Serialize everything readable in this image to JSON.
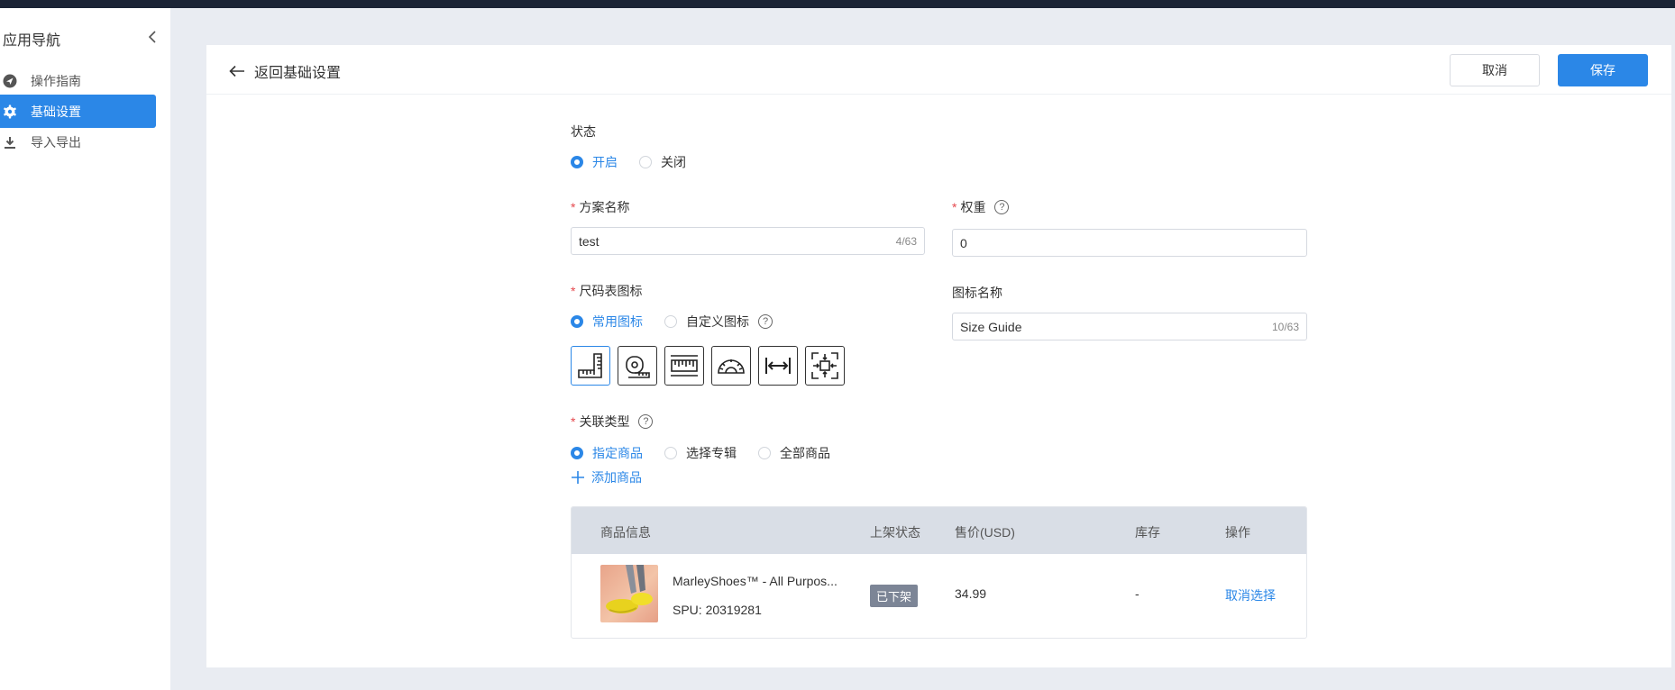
{
  "sidebar": {
    "title": "应用导航",
    "items": [
      {
        "label": "操作指南",
        "icon": "send-icon",
        "active": false
      },
      {
        "label": "基础设置",
        "icon": "gear-icon",
        "active": true
      },
      {
        "label": "导入导出",
        "icon": "download-icon",
        "active": false
      }
    ]
  },
  "header": {
    "back_label": "返回基础设置",
    "cancel_label": "取消",
    "save_label": "保存"
  },
  "form": {
    "status": {
      "label": "状态",
      "options": [
        "开启",
        "关闭"
      ],
      "selected": "开启"
    },
    "plan_name": {
      "label": "方案名称",
      "value": "test",
      "count": "4/63"
    },
    "weight": {
      "label": "权重",
      "value": "0"
    },
    "size_icon": {
      "label": "尺码表图标",
      "options": [
        "常用图标",
        "自定义图标"
      ],
      "selected": "常用图标",
      "icons": [
        "ruler-corner-icon",
        "tape-measure-icon",
        "ruler-icon",
        "protractor-icon",
        "width-arrows-icon",
        "dimension-frame-icon"
      ]
    },
    "icon_name": {
      "label": "图标名称",
      "value": "Size Guide",
      "count": "10/63"
    },
    "relation_type": {
      "label": "关联类型",
      "options": [
        "指定商品",
        "选择专辑",
        "全部商品"
      ],
      "selected": "指定商品"
    },
    "add_product_label": "添加商品"
  },
  "table": {
    "columns": [
      "商品信息",
      "上架状态",
      "售价(USD)",
      "库存",
      "操作"
    ],
    "rows": [
      {
        "name": "MarleyShoes™ - All Purpos...",
        "spu": "SPU: 20319281",
        "status": "已下架",
        "price": "34.99",
        "stock": "-",
        "action": "取消选择"
      }
    ]
  },
  "colors": {
    "accent": "#2b87e7",
    "topbar": "#1b2436",
    "required": "#e5484d"
  }
}
